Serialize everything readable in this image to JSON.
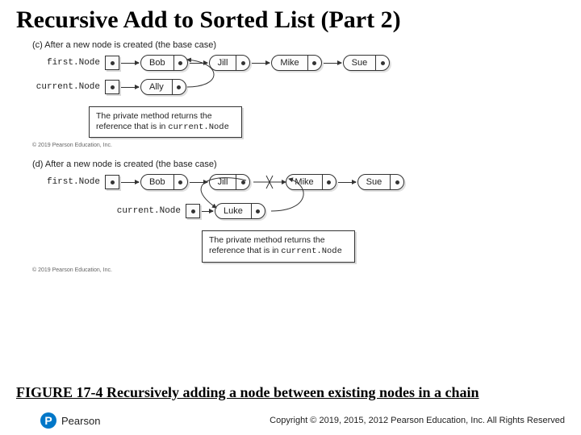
{
  "title": "Recursive Add to Sorted List (Part 2)",
  "diagram": {
    "c": {
      "caption": "(c) After a new node is created (the base case)",
      "first_label": "first.Node",
      "current_label": "current.Node",
      "chain": [
        "Bob",
        "Jill",
        "Mike",
        "Sue"
      ],
      "new_node": "Ally",
      "note_line1": "The private method returns the",
      "note_line2_a": "reference that is in ",
      "note_line2_b": "current.Node"
    },
    "d": {
      "caption": "(d) After a new node is created (the base case)",
      "first_label": "first.Node",
      "current_label": "current.Node",
      "chain": [
        "Bob",
        "Jill",
        "Mike",
        "Sue"
      ],
      "new_node": "Luke",
      "note_line1": "The private method returns the",
      "note_line2_a": "reference that is in ",
      "note_line2_b": "current.Node"
    },
    "copyright_tiny": "© 2019 Pearson Education, Inc."
  },
  "figure_caption_a": "FIGURE 17-4 ",
  "figure_caption_b": "Recursively adding a node between existing nodes in a chain",
  "footer": "Copyright © 2019, 2015, 2012 Pearson Education, Inc. All Rights Reserved",
  "brand": "Pearson",
  "brand_p": "P"
}
